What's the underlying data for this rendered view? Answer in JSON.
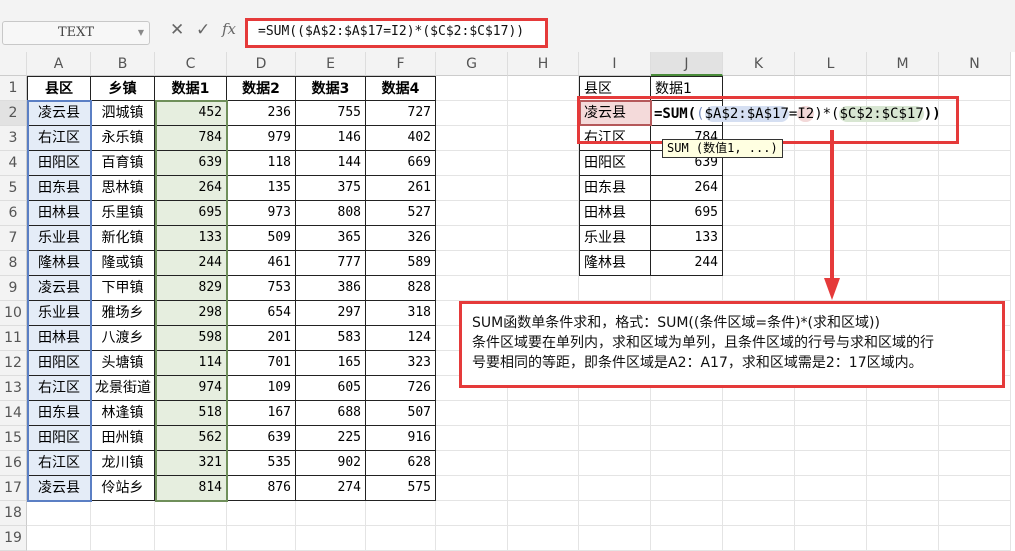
{
  "name_box": "TEXT",
  "formula_bar": {
    "cancel": "✕",
    "confirm": "✓",
    "fx": "fx",
    "formula": "=SUM(($A$2:$A$17=I2)*($C$2:$C$17))"
  },
  "columns": [
    "A",
    "B",
    "C",
    "D",
    "E",
    "F",
    "G",
    "H",
    "I",
    "J",
    "K",
    "L",
    "M",
    "N"
  ],
  "rows": [
    "1",
    "2",
    "3",
    "4",
    "5",
    "6",
    "7",
    "8",
    "9",
    "10",
    "11",
    "12",
    "13",
    "14",
    "15",
    "16",
    "17",
    "18",
    "19"
  ],
  "table": {
    "headers": [
      "县区",
      "乡镇",
      "数据1",
      "数据2",
      "数据3",
      "数据4"
    ],
    "rows": [
      [
        "凌云县",
        "泗城镇",
        "452",
        "236",
        "755",
        "727"
      ],
      [
        "右江区",
        "永乐镇",
        "784",
        "979",
        "146",
        "402"
      ],
      [
        "田阳区",
        "百育镇",
        "639",
        "118",
        "144",
        "669"
      ],
      [
        "田东县",
        "思林镇",
        "264",
        "135",
        "375",
        "261"
      ],
      [
        "田林县",
        "乐里镇",
        "695",
        "973",
        "808",
        "527"
      ],
      [
        "乐业县",
        "新化镇",
        "133",
        "509",
        "365",
        "326"
      ],
      [
        "隆林县",
        "隆或镇",
        "244",
        "461",
        "777",
        "589"
      ],
      [
        "凌云县",
        "下甲镇",
        "829",
        "753",
        "386",
        "828"
      ],
      [
        "乐业县",
        "雅场乡",
        "298",
        "654",
        "297",
        "318"
      ],
      [
        "田林县",
        "八渡乡",
        "598",
        "201",
        "583",
        "124"
      ],
      [
        "田阳区",
        "头塘镇",
        "114",
        "701",
        "165",
        "323"
      ],
      [
        "右江区",
        "龙景街道",
        "974",
        "109",
        "605",
        "726"
      ],
      [
        "田东县",
        "林逢镇",
        "518",
        "167",
        "688",
        "507"
      ],
      [
        "田阳区",
        "田州镇",
        "562",
        "639",
        "225",
        "916"
      ],
      [
        "右江区",
        "龙川镇",
        "321",
        "535",
        "902",
        "628"
      ],
      [
        "凌云县",
        "伶站乡",
        "814",
        "876",
        "274",
        "575"
      ]
    ]
  },
  "lookup": {
    "headers": [
      "县区",
      "数据1"
    ],
    "rows": [
      [
        "凌云县",
        ""
      ],
      [
        "右江区",
        "784"
      ],
      [
        "田阳区",
        "639"
      ],
      [
        "田东县",
        "264"
      ],
      [
        "田林县",
        "695"
      ],
      [
        "乐业县",
        "133"
      ],
      [
        "隆林县",
        "244"
      ]
    ]
  },
  "in_cell_formula": {
    "eq": "=SUM(",
    "p1": "(",
    "range_a": "$A$2:$A$17",
    "eqs": "=",
    "crit": "I2",
    "p2": ")*(",
    "range_c": "$C$2:$C$17",
    "end": "))"
  },
  "tooltip": "SUM (数值1, ...)",
  "note": {
    "line1": "SUM函数单条件求和，格式：SUM((条件区域=条件)*(求和区域))",
    "line2": "条件区域要在单列内，求和区域为单列，且条件区域的行号与求和区域的行",
    "line3": "号要相同的等距，即条件区域是A2：A17，求和区域需是2：17区域内。"
  },
  "colors": {
    "highlight": "#e53a3a"
  }
}
